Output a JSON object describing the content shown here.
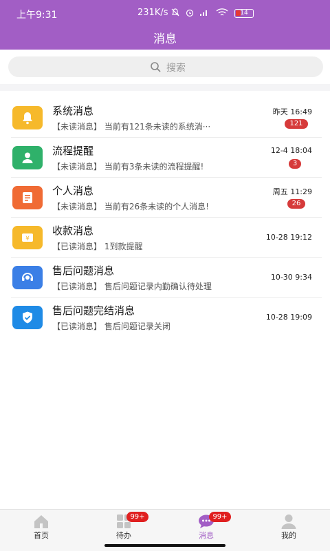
{
  "status_bar": {
    "time": "上午9:31",
    "net_speed": "231K/s",
    "battery_level": "14"
  },
  "header": {
    "title": "消息"
  },
  "search": {
    "placeholder": "搜索"
  },
  "messages": [
    {
      "title": "系统消息",
      "summary": "【未读消息】 当前有121条未读的系统消···",
      "time": "昨天 16:49",
      "badge": "121",
      "icon": "bell-icon",
      "color": "#f6b92b"
    },
    {
      "title": "流程提醒",
      "summary": "【未读消息】 当前有3条未读的流程提醒!",
      "time": "12-4 18:04",
      "badge": "3",
      "icon": "user-icon",
      "color": "#2fb16a"
    },
    {
      "title": "个人消息",
      "summary": "【未读消息】 当前有26条未读的个人消息!",
      "time": "周五 11:29",
      "badge": "26",
      "icon": "document-icon",
      "color": "#f06b34"
    },
    {
      "title": "收款消息",
      "summary": "【已读消息】 1到款提醒",
      "time": "10-28 19:12",
      "badge": "",
      "icon": "wallet-yen-icon",
      "color": "#f6b92b"
    },
    {
      "title": "售后问题消息",
      "summary": "【已读消息】 售后问题记录内勤确认待处理",
      "time": "10-30 9:34",
      "badge": "",
      "icon": "headset-icon",
      "color": "#3b7fe6"
    },
    {
      "title": "售后问题完结消息",
      "summary": "【已读消息】 售后问题记录关闭",
      "time": "10-28 19:09",
      "badge": "",
      "icon": "shield-check-icon",
      "color": "#1f8be6"
    }
  ],
  "bottom_nav": {
    "items": [
      {
        "label": "首页",
        "badge": "",
        "active": false
      },
      {
        "label": "待办",
        "badge": "99+",
        "active": false
      },
      {
        "label": "消息",
        "badge": "99+",
        "active": true
      },
      {
        "label": "我的",
        "badge": "",
        "active": false
      }
    ]
  },
  "colors": {
    "header": "#a25ec5",
    "badge": "#d63a3a",
    "active_tab": "#a25ec5"
  }
}
